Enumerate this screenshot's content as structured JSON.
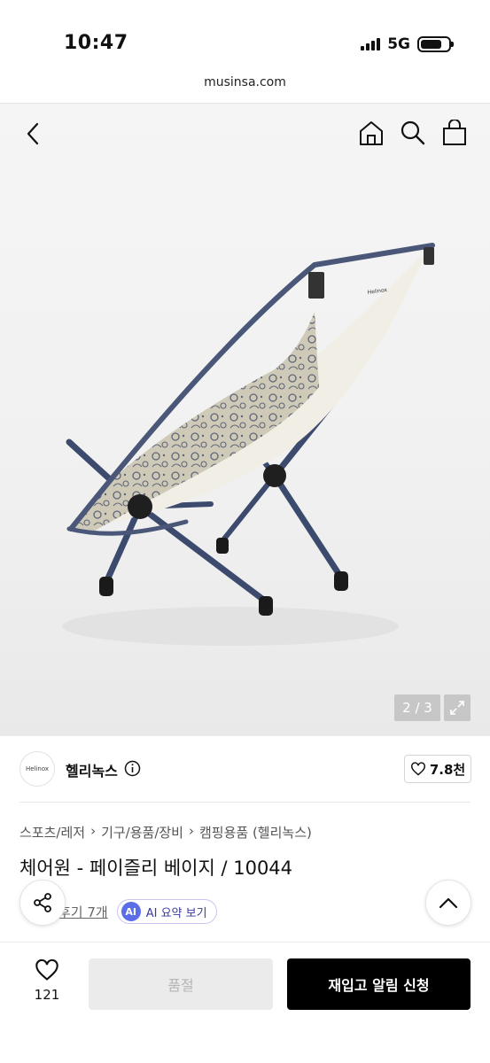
{
  "status": {
    "time": "10:47",
    "network": "5G"
  },
  "browser": {
    "url": "musinsa.com"
  },
  "gallery": {
    "counter": "2 / 3"
  },
  "brand": {
    "name": "헬리녹스",
    "logo_text": "Helinox",
    "likes": "7.8천"
  },
  "breadcrumb": [
    "스포츠/레저",
    "기구/용품/장비",
    "캠핑용품 (헬리녹스)"
  ],
  "product": {
    "title": "체어원 - 페이즐리 베이지 / 10044"
  },
  "review": {
    "link": "후기 7개",
    "ai_badge": "AI",
    "ai_label": "AI 요약 보기"
  },
  "bottom": {
    "wish_count": "121",
    "soldout_label": "품절",
    "restock_label": "재입고 알림 신청"
  }
}
